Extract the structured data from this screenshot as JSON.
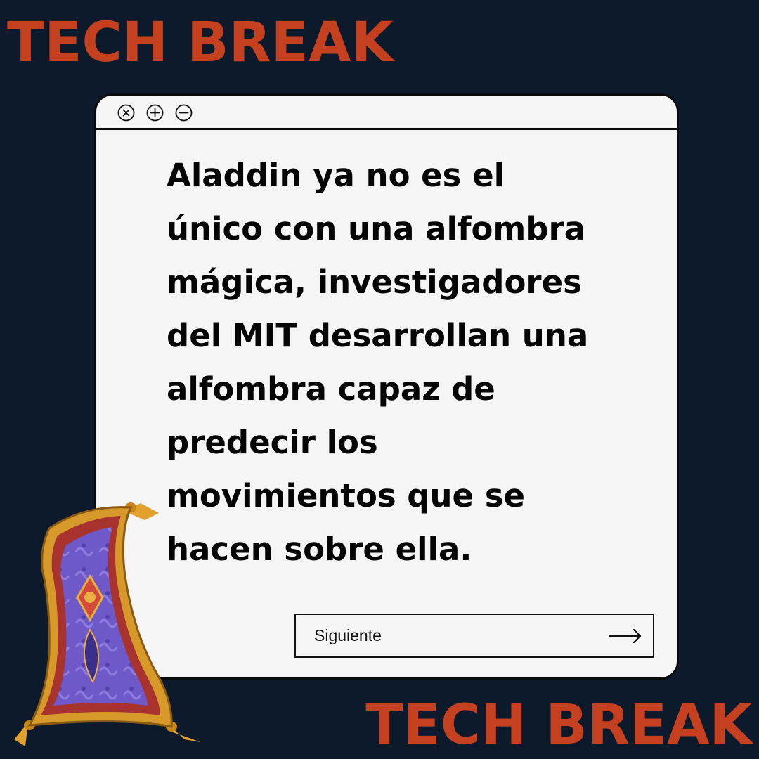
{
  "brand": {
    "top": "TECH BREAK",
    "bottom": "TECH BREAK",
    "color": "#c4401f"
  },
  "window": {
    "controls": [
      "close-icon",
      "plus-icon",
      "minus-icon"
    ],
    "message_lines": [
      "Aladdin ya no es el",
      "único con una alfombra",
      "mágica, investigadores",
      "del MIT desarrollan una",
      "alfombra capaz de",
      "predecir los",
      "movimientos que se",
      "hacen sobre ella."
    ],
    "next_button": {
      "label": "Siguiente",
      "icon": "arrow-right-icon"
    }
  },
  "colors": {
    "background": "#0d1a2b",
    "window": "#f4f5f4",
    "border": "#0b0b0b"
  },
  "illustration": "magic-carpet-icon"
}
